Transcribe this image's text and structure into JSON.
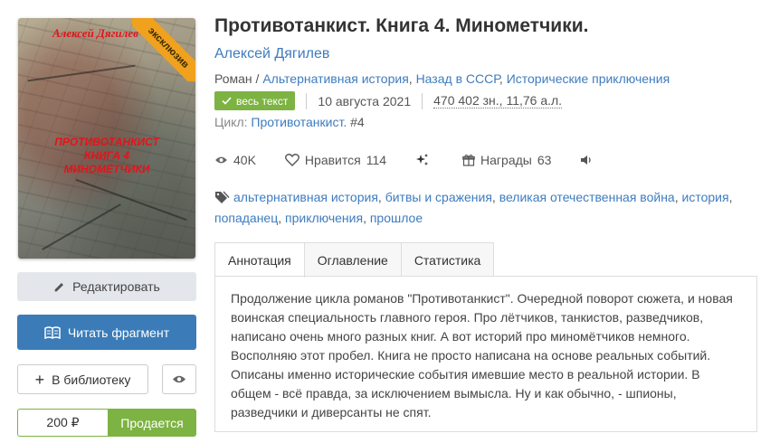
{
  "cover": {
    "author": "Алексей Дягилев",
    "title_lines": [
      "ПРОТИВОТАНКИСТ",
      "КНИГА 4",
      "МИНОМЁТЧИКИ"
    ],
    "ribbon": "эксклюзив"
  },
  "buttons": {
    "edit": "Редактировать",
    "read": "Читать фрагмент",
    "library": "В библиотеку",
    "price": "200 ₽",
    "sale": "Продается"
  },
  "book": {
    "title": "Противотанкист. Книга 4. Минометчики.",
    "author": "Алексей Дягилев",
    "genres": [
      "Роман",
      "Альтернативная история",
      "Назад в СССР",
      "Исторические приключения"
    ],
    "full_text_badge": "весь текст",
    "date": "10 августа 2021",
    "size": "470 402 зн., 11,76 а.л.",
    "cycle_label": "Цикл:",
    "cycle_name": "Противотанкист.",
    "cycle_num": "#4"
  },
  "stats": {
    "views": "40K",
    "likes_label": "Нравится",
    "likes": "114",
    "awards_label": "Награды",
    "awards": "63"
  },
  "tags": [
    "альтернативная история",
    "битвы и сражения",
    "великая отечественная война",
    "история",
    "попаданец",
    "приключения",
    "прошлое"
  ],
  "tabs": [
    "Аннотация",
    "Оглавление",
    "Статистика"
  ],
  "annotation": "Продолжение цикла романов \"Противотанкист\". Очередной поворот сюжета, и новая воинская специальность главного героя. Про лётчиков, танкистов, разведчиков, написано очень много разных книг. А вот историй про миномётчиков немного. Восполняю этот пробел. Книга не просто написана на основе реальных событий. Описаны именно исторические события имевшие место в реальной истории. В общем - всё правда, за исключением вымысла. Ну и как обычно, - шпионы, разведчики и диверсанты не спят.",
  "colors": {
    "link": "#3e7cbf",
    "primary_button": "#3b7cb8",
    "green": "#7cb342",
    "ribbon": "#f0a11d",
    "cover_text": "#e3141b"
  }
}
